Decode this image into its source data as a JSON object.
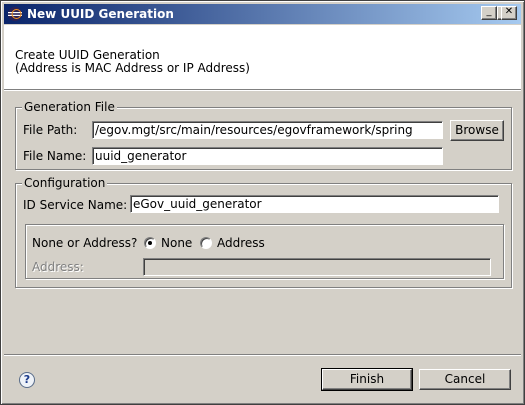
{
  "window": {
    "title": "New UUID Generation",
    "controls": {
      "minimize": "_",
      "maximize": "□",
      "close": "✕"
    }
  },
  "header": {
    "line1": "Create UUID Generation",
    "line2": "(Address is MAC Address or IP Address)"
  },
  "generation_file": {
    "group_label": "Generation File",
    "file_path_label": "File Path:",
    "file_path_value": "/egov.mgt/src/main/resources/egovframework/spring",
    "browse_label": "Browse",
    "file_name_label": "File Name:",
    "file_name_value": "uuid_generator"
  },
  "configuration": {
    "group_label": "Configuration",
    "id_service_label": "ID Service Name:",
    "id_service_value": "eGov_uuid_generator",
    "address_question": "None or Address?",
    "options": [
      "None",
      "Address"
    ],
    "selected_option": "None",
    "address_label": "Address:",
    "address_value": ""
  },
  "footer": {
    "help_icon": "?",
    "finish_label": "Finish",
    "cancel_label": "Cancel"
  },
  "colors": {
    "title_start": "#0a246a",
    "title_end": "#a6caf0",
    "dialog_bg": "#d4d0c8"
  }
}
